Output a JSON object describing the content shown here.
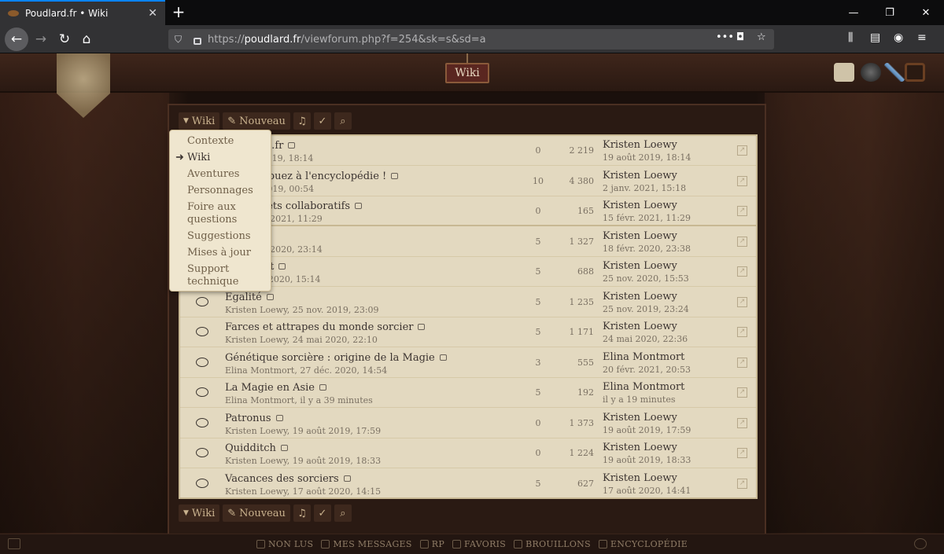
{
  "browser": {
    "tab_title": "Poudlard.fr • Wiki",
    "tab_close": "✕",
    "new_tab": "+",
    "url_base": "https://",
    "url_host": "poudlard.fr",
    "url_path": "/viewforum.php?f=254&sk=s&sd=a",
    "page_actions": "•••"
  },
  "header": {
    "sign": "Wiki"
  },
  "toolbar": {
    "forum_label": "Wiki",
    "new_label": "Nouveau"
  },
  "dropdown": {
    "items": [
      {
        "label": "Contexte",
        "active": false
      },
      {
        "label": "Wiki",
        "active": true
      },
      {
        "label": "Aventures",
        "active": false
      },
      {
        "label": "Personnages",
        "active": false
      },
      {
        "label": "Foire aux questions",
        "active": false
      },
      {
        "label": "Suggestions",
        "active": false
      },
      {
        "label": "Mises à jour",
        "active": false
      },
      {
        "label": "Support technique",
        "active": false
      }
    ],
    "active_arrow": "➜"
  },
  "topics": [
    {
      "title": "Poudlard.fr",
      "meta": "19 août 2019, 18:14",
      "replies": "0",
      "views": "2 219",
      "last_author": "Kristen Loewy",
      "last_date": "19 août 2019, 18:14"
    },
    {
      "title": "S Contribuez à l'encyclopédie !",
      "meta": "y, 1 oct. 2019, 00:54",
      "replies": "10",
      "views": "4 380",
      "last_author": "Kristen Loewy",
      "last_date": "2 janv. 2021, 15:18"
    },
    {
      "title": "des projets collaboratifs",
      "meta": "y, 15 févr. 2021, 11:29",
      "replies": "0",
      "views": "165",
      "last_author": "Kristen Loewy",
      "last_date": "15 févr. 2021, 11:29"
    },
    {
      "title": "e",
      "meta": "y, 18 févr. 2020, 23:14",
      "replies": "5",
      "views": "1 327",
      "last_author": "Kristen Loewy",
      "last_date": "18 févr. 2020, 23:38"
    },
    {
      "title": "de la nuit",
      "meta": "y, 25 nov. 2020, 15:14",
      "replies": "5",
      "views": "688",
      "last_author": "Kristen Loewy",
      "last_date": "25 nov. 2020, 15:53"
    },
    {
      "title": "Egalité",
      "meta": "Kristen Loewy, 25 nov. 2019, 23:09",
      "replies": "5",
      "views": "1 235",
      "last_author": "Kristen Loewy",
      "last_date": "25 nov. 2019, 23:24"
    },
    {
      "title": "Farces et attrapes du monde sorcier",
      "meta": "Kristen Loewy, 24 mai 2020, 22:10",
      "replies": "5",
      "views": "1 171",
      "last_author": "Kristen Loewy",
      "last_date": "24 mai 2020, 22:36"
    },
    {
      "title": "Génétique sorcière : origine de la Magie",
      "meta": "Elina Montmort, 27 déc. 2020, 14:54",
      "replies": "3",
      "views": "555",
      "last_author": "Elina Montmort",
      "last_date": "20 févr. 2021, 20:53"
    },
    {
      "title": "La Magie en Asie",
      "meta": "Elina Montmort, il y a 39 minutes",
      "replies": "5",
      "views": "192",
      "last_author": "Elina Montmort",
      "last_date": "il y a 19 minutes"
    },
    {
      "title": "Patronus",
      "meta": "Kristen Loewy, 19 août 2019, 17:59",
      "replies": "0",
      "views": "1 373",
      "last_author": "Kristen Loewy",
      "last_date": "19 août 2019, 17:59"
    },
    {
      "title": "Quidditch",
      "meta": "Kristen Loewy, 19 août 2019, 18:33",
      "replies": "0",
      "views": "1 224",
      "last_author": "Kristen Loewy",
      "last_date": "19 août 2019, 18:33"
    },
    {
      "title": "Vacances des sorciers",
      "meta": "Kristen Loewy, 17 août 2020, 14:15",
      "replies": "5",
      "views": "627",
      "last_author": "Kristen Loewy",
      "last_date": "17 août 2020, 14:41"
    }
  ],
  "footer_nav": [
    "NON LUS",
    "MES MESSAGES",
    "RP",
    "FAVORIS",
    "BROUILLONS",
    "ENCYCLOPÉDIE"
  ]
}
